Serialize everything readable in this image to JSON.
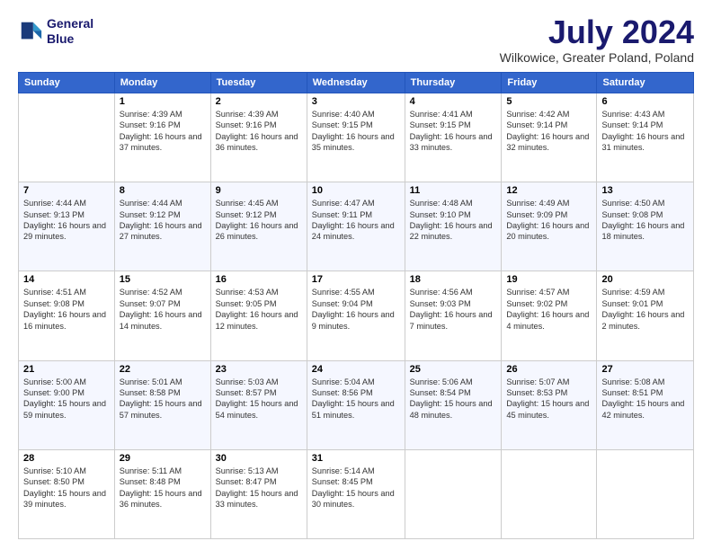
{
  "header": {
    "logo_line1": "General",
    "logo_line2": "Blue",
    "month": "July 2024",
    "location": "Wilkowice, Greater Poland, Poland"
  },
  "days_of_week": [
    "Sunday",
    "Monday",
    "Tuesday",
    "Wednesday",
    "Thursday",
    "Friday",
    "Saturday"
  ],
  "weeks": [
    [
      {
        "day": "",
        "sunrise": "",
        "sunset": "",
        "daylight": ""
      },
      {
        "day": "1",
        "sunrise": "Sunrise: 4:39 AM",
        "sunset": "Sunset: 9:16 PM",
        "daylight": "Daylight: 16 hours and 37 minutes."
      },
      {
        "day": "2",
        "sunrise": "Sunrise: 4:39 AM",
        "sunset": "Sunset: 9:16 PM",
        "daylight": "Daylight: 16 hours and 36 minutes."
      },
      {
        "day": "3",
        "sunrise": "Sunrise: 4:40 AM",
        "sunset": "Sunset: 9:15 PM",
        "daylight": "Daylight: 16 hours and 35 minutes."
      },
      {
        "day": "4",
        "sunrise": "Sunrise: 4:41 AM",
        "sunset": "Sunset: 9:15 PM",
        "daylight": "Daylight: 16 hours and 33 minutes."
      },
      {
        "day": "5",
        "sunrise": "Sunrise: 4:42 AM",
        "sunset": "Sunset: 9:14 PM",
        "daylight": "Daylight: 16 hours and 32 minutes."
      },
      {
        "day": "6",
        "sunrise": "Sunrise: 4:43 AM",
        "sunset": "Sunset: 9:14 PM",
        "daylight": "Daylight: 16 hours and 31 minutes."
      }
    ],
    [
      {
        "day": "7",
        "sunrise": "Sunrise: 4:44 AM",
        "sunset": "Sunset: 9:13 PM",
        "daylight": "Daylight: 16 hours and 29 minutes."
      },
      {
        "day": "8",
        "sunrise": "Sunrise: 4:44 AM",
        "sunset": "Sunset: 9:12 PM",
        "daylight": "Daylight: 16 hours and 27 minutes."
      },
      {
        "day": "9",
        "sunrise": "Sunrise: 4:45 AM",
        "sunset": "Sunset: 9:12 PM",
        "daylight": "Daylight: 16 hours and 26 minutes."
      },
      {
        "day": "10",
        "sunrise": "Sunrise: 4:47 AM",
        "sunset": "Sunset: 9:11 PM",
        "daylight": "Daylight: 16 hours and 24 minutes."
      },
      {
        "day": "11",
        "sunrise": "Sunrise: 4:48 AM",
        "sunset": "Sunset: 9:10 PM",
        "daylight": "Daylight: 16 hours and 22 minutes."
      },
      {
        "day": "12",
        "sunrise": "Sunrise: 4:49 AM",
        "sunset": "Sunset: 9:09 PM",
        "daylight": "Daylight: 16 hours and 20 minutes."
      },
      {
        "day": "13",
        "sunrise": "Sunrise: 4:50 AM",
        "sunset": "Sunset: 9:08 PM",
        "daylight": "Daylight: 16 hours and 18 minutes."
      }
    ],
    [
      {
        "day": "14",
        "sunrise": "Sunrise: 4:51 AM",
        "sunset": "Sunset: 9:08 PM",
        "daylight": "Daylight: 16 hours and 16 minutes."
      },
      {
        "day": "15",
        "sunrise": "Sunrise: 4:52 AM",
        "sunset": "Sunset: 9:07 PM",
        "daylight": "Daylight: 16 hours and 14 minutes."
      },
      {
        "day": "16",
        "sunrise": "Sunrise: 4:53 AM",
        "sunset": "Sunset: 9:05 PM",
        "daylight": "Daylight: 16 hours and 12 minutes."
      },
      {
        "day": "17",
        "sunrise": "Sunrise: 4:55 AM",
        "sunset": "Sunset: 9:04 PM",
        "daylight": "Daylight: 16 hours and 9 minutes."
      },
      {
        "day": "18",
        "sunrise": "Sunrise: 4:56 AM",
        "sunset": "Sunset: 9:03 PM",
        "daylight": "Daylight: 16 hours and 7 minutes."
      },
      {
        "day": "19",
        "sunrise": "Sunrise: 4:57 AM",
        "sunset": "Sunset: 9:02 PM",
        "daylight": "Daylight: 16 hours and 4 minutes."
      },
      {
        "day": "20",
        "sunrise": "Sunrise: 4:59 AM",
        "sunset": "Sunset: 9:01 PM",
        "daylight": "Daylight: 16 hours and 2 minutes."
      }
    ],
    [
      {
        "day": "21",
        "sunrise": "Sunrise: 5:00 AM",
        "sunset": "Sunset: 9:00 PM",
        "daylight": "Daylight: 15 hours and 59 minutes."
      },
      {
        "day": "22",
        "sunrise": "Sunrise: 5:01 AM",
        "sunset": "Sunset: 8:58 PM",
        "daylight": "Daylight: 15 hours and 57 minutes."
      },
      {
        "day": "23",
        "sunrise": "Sunrise: 5:03 AM",
        "sunset": "Sunset: 8:57 PM",
        "daylight": "Daylight: 15 hours and 54 minutes."
      },
      {
        "day": "24",
        "sunrise": "Sunrise: 5:04 AM",
        "sunset": "Sunset: 8:56 PM",
        "daylight": "Daylight: 15 hours and 51 minutes."
      },
      {
        "day": "25",
        "sunrise": "Sunrise: 5:06 AM",
        "sunset": "Sunset: 8:54 PM",
        "daylight": "Daylight: 15 hours and 48 minutes."
      },
      {
        "day": "26",
        "sunrise": "Sunrise: 5:07 AM",
        "sunset": "Sunset: 8:53 PM",
        "daylight": "Daylight: 15 hours and 45 minutes."
      },
      {
        "day": "27",
        "sunrise": "Sunrise: 5:08 AM",
        "sunset": "Sunset: 8:51 PM",
        "daylight": "Daylight: 15 hours and 42 minutes."
      }
    ],
    [
      {
        "day": "28",
        "sunrise": "Sunrise: 5:10 AM",
        "sunset": "Sunset: 8:50 PM",
        "daylight": "Daylight: 15 hours and 39 minutes."
      },
      {
        "day": "29",
        "sunrise": "Sunrise: 5:11 AM",
        "sunset": "Sunset: 8:48 PM",
        "daylight": "Daylight: 15 hours and 36 minutes."
      },
      {
        "day": "30",
        "sunrise": "Sunrise: 5:13 AM",
        "sunset": "Sunset: 8:47 PM",
        "daylight": "Daylight: 15 hours and 33 minutes."
      },
      {
        "day": "31",
        "sunrise": "Sunrise: 5:14 AM",
        "sunset": "Sunset: 8:45 PM",
        "daylight": "Daylight: 15 hours and 30 minutes."
      },
      {
        "day": "",
        "sunrise": "",
        "sunset": "",
        "daylight": ""
      },
      {
        "day": "",
        "sunrise": "",
        "sunset": "",
        "daylight": ""
      },
      {
        "day": "",
        "sunrise": "",
        "sunset": "",
        "daylight": ""
      }
    ]
  ]
}
